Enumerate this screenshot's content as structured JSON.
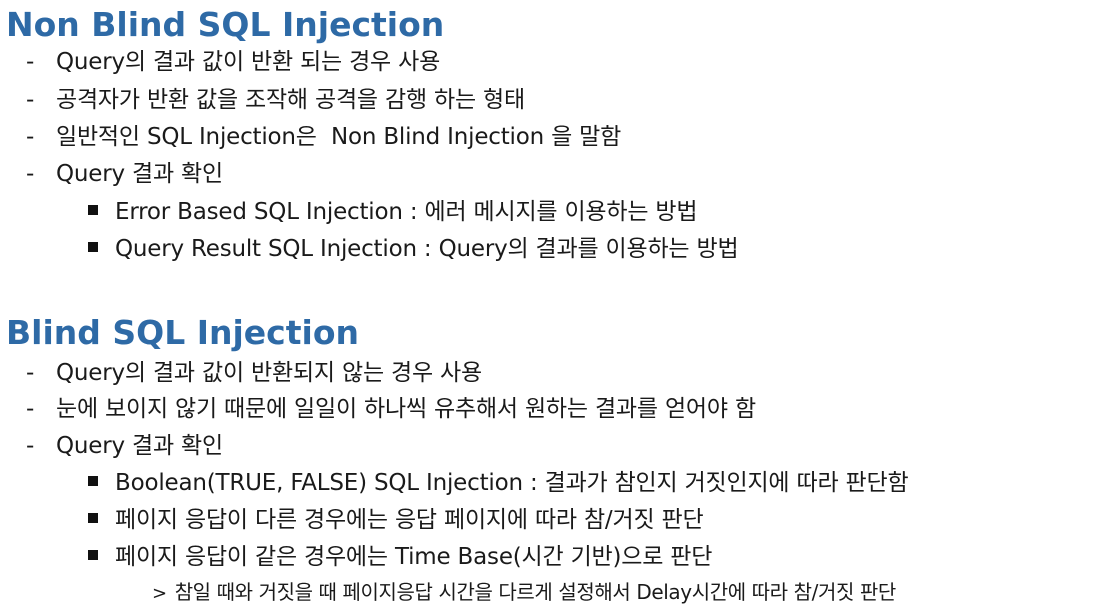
{
  "section_nonblind": {
    "title": "Non Blind SQL Injection",
    "bullets": [
      "Query의 결과 값이 반환 되는 경우 사용",
      "공격자가 반환 값을 조작해 공격을 감행 하는 형태",
      "일반적인 SQL Injection은  Non Blind Injection 을 말함",
      "Query 결과 확인"
    ],
    "sub_bullets": [
      "Error Based SQL Injection : 에러 메시지를 이용하는 방법",
      "Query Result SQL Injection : Query의 결과를 이용하는 방법"
    ]
  },
  "section_blind": {
    "title": "Blind SQL Injection",
    "bullets": [
      "Query의 결과 값이 반환되지 않는 경우 사용",
      "눈에 보이지 않기 때문에 일일이 하나씩 유추해서 원하는 결과를 얻어야 함",
      "Query 결과 확인"
    ],
    "sub_bullets": [
      "Boolean(TRUE, FALSE) SQL Injection : 결과가 참인지 거짓인지에 따라 판단함",
      "페이지 응답이 다른 경우에는 응답 페이지에 따라 참/거짓 판단",
      "페이지 응답이 같은 경우에는 Time Base(시간 기반)으로 판단"
    ],
    "detail": "참일 때와 거짓을 때 페이지응답 시간을 다르게 설정해서 Delay시간에 따라 참/거짓 판단"
  },
  "markers": {
    "dash": "-",
    "arrow": ">"
  }
}
